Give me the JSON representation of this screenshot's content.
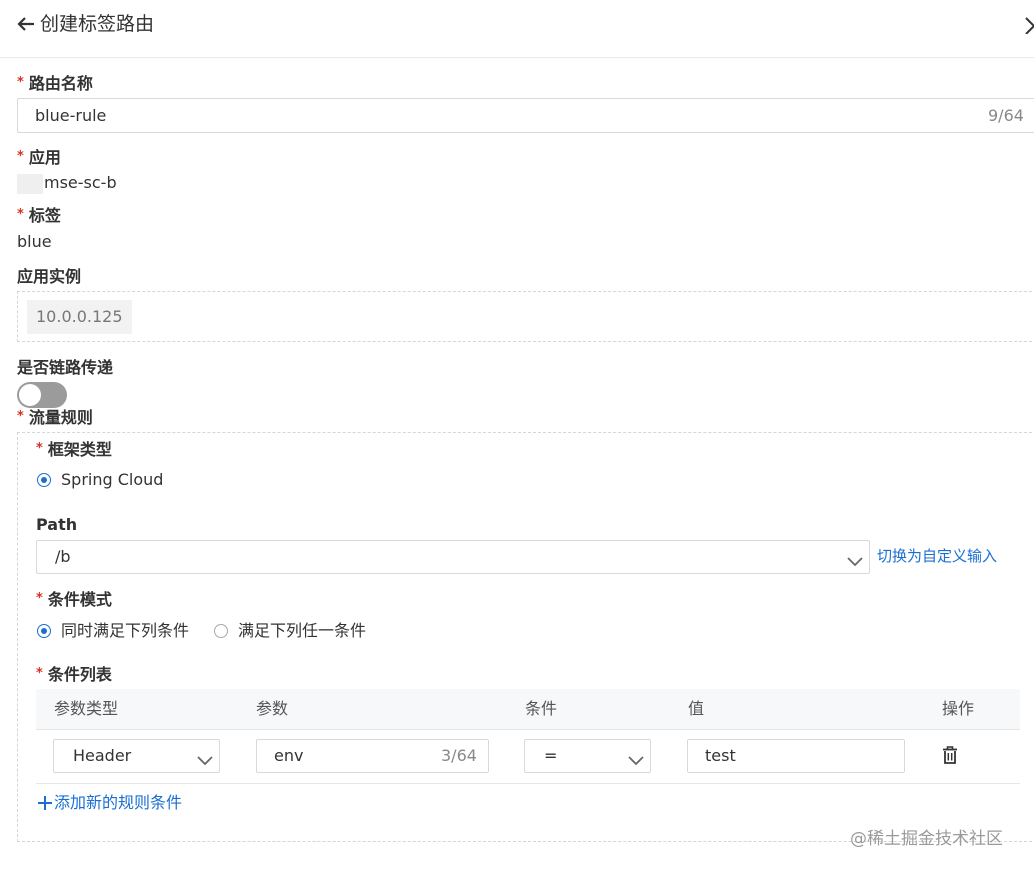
{
  "header": {
    "title": "创建标签路由"
  },
  "route_name": {
    "label": "路由名称",
    "value": "blue-rule",
    "counter": "9/64"
  },
  "app": {
    "label": "应用",
    "value": "mse-sc-b"
  },
  "tag": {
    "label": "标签",
    "value": "blue"
  },
  "instances": {
    "label": "应用实例",
    "items": [
      "10.0.0.125"
    ]
  },
  "chain": {
    "label": "是否链路传递",
    "enabled": false
  },
  "traffic": {
    "label": "流量规则",
    "framework": {
      "label": "框架类型",
      "option": "Spring Cloud",
      "selected": true
    },
    "path": {
      "label": "Path",
      "value": "/b",
      "switch_link": "切换为自定义输入"
    },
    "condition_mode": {
      "label": "条件模式",
      "options": [
        {
          "label": "同时满足下列条件",
          "selected": true
        },
        {
          "label": "满足下列任一条件",
          "selected": false
        }
      ]
    },
    "condition_list": {
      "label": "条件列表",
      "headers": [
        "参数类型",
        "参数",
        "条件",
        "值",
        "操作"
      ],
      "rows": [
        {
          "param_type": "Header",
          "param": "env",
          "param_counter": "3/64",
          "operator": "=",
          "value": "test"
        }
      ],
      "add_link": "添加新的规则条件"
    }
  },
  "watermark": "@稀土掘金技术社区",
  "colors": {
    "accent": "#1a6fd0",
    "required": "#d93026",
    "switch_off": "#9b9b9b"
  }
}
